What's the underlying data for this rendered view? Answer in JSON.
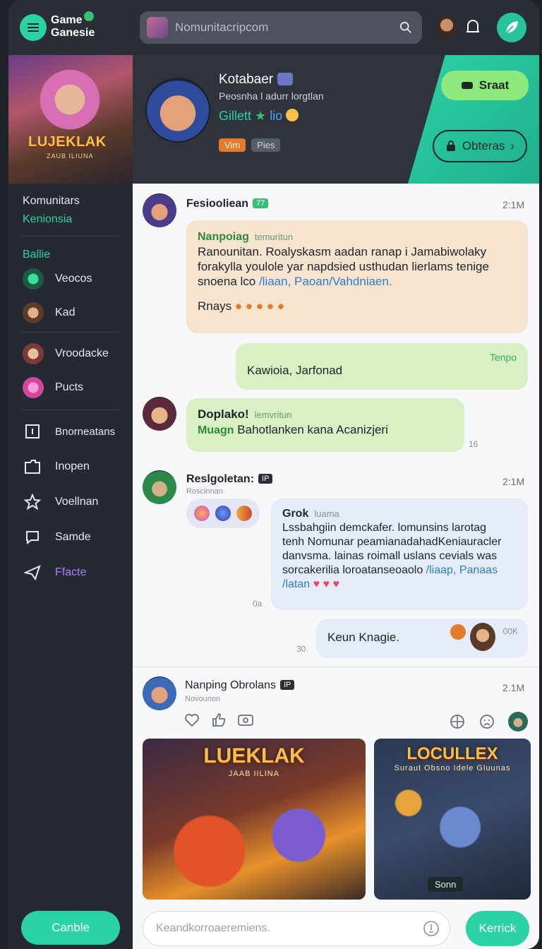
{
  "header": {
    "brand_line1": "Game",
    "brand_line2": "Ganesie",
    "search_placeholder": "Nomunitacripcom"
  },
  "sidebar": {
    "banner_title": "LUJEKLAK",
    "banner_subtitle": "ZAUB ILIUNA",
    "section_title": "Komunitars",
    "section_sub": "Kenionsia",
    "group_label": "Ballie",
    "items": [
      {
        "label": "Veocos",
        "icon": "green-orb-icon"
      },
      {
        "label": "Kad",
        "icon": "hero-avatar-icon"
      },
      {
        "label": "Vroodacke",
        "icon": "hero-avatar-icon"
      },
      {
        "label": "Pucts",
        "icon": "pink-orb-icon"
      }
    ],
    "nav": [
      {
        "label": "Bnorneatans",
        "icon": "square-icon"
      },
      {
        "label": "Inopen",
        "icon": "folder-icon"
      },
      {
        "label": "Voellnan",
        "icon": "star-icon"
      },
      {
        "label": "Samde",
        "icon": "chat-icon"
      },
      {
        "label": "Ffacte",
        "icon": "send-icon"
      }
    ],
    "cancel_label": "Canble"
  },
  "profile": {
    "name": "Kotabaer",
    "subtitle": "Peosnha l adurr lorgtlan",
    "stat_text": "Gillett",
    "stat_extra": "lio",
    "tag1": "Vim",
    "tag2": "Pies",
    "start_label": "Sraat",
    "others_label": "Obteras"
  },
  "messages": [
    {
      "user": "Fesiooliean",
      "badge": "77",
      "time": "2:1M",
      "bubble_name": "Nanpoiag",
      "bubble_meta": "temuritun",
      "text_lines": [
        "Ranounitan. Roalyskasm aadan ranap i Jamabiwolaky",
        "forakylla youlole yar napdsied usthudan lierlams tenige",
        "snoena lco "
      ],
      "link": "/liaan, Paoan/Vahdniaen.",
      "reply_line": "Rnays"
    },
    {
      "self_tag": "Tenpo",
      "text": "Kawioia, Jarfonad"
    },
    {
      "bubble_name": "Doplako!",
      "bubble_meta": "lemvritun",
      "line_prefix": "Muagn",
      "text": "Bahotlanken kana Acanizjeri",
      "side_num": "16"
    },
    {
      "user": "Reslgoletan:",
      "badge": "IP",
      "sub": "Roscinnan",
      "time": "2:1M",
      "bubble_name": "Grok",
      "bubble_meta": "luama",
      "text_lines": [
        "Lssbahgiin demckafer. lomunsins larotag",
        "tenh Nomunar peamianadahadKeniauracler",
        "danvsma. lainas roimall uslans cevials was",
        "sorcakerilia loroatanseoaolo "
      ],
      "link": "/liaap, Panaas",
      "link2": "/latan",
      "side_num": "0a"
    },
    {
      "text": "Keun Knagie.",
      "count": "00K",
      "side_num": "30."
    }
  ],
  "post": {
    "user": "Nanping Obrolans",
    "badge": "IP",
    "sub": "Novounon",
    "time": "2.1M",
    "card1_title": "LUEKLAK",
    "card1_sub": "JAAB IILINA",
    "card2_title": "LOCULLEX",
    "card2_sub": "Suraut Obsno Idele Gluunas",
    "card2_tag": "Sonn"
  },
  "composer": {
    "placeholder": "Keandkorroaeremiens.",
    "send_label": "Kerrick"
  },
  "colors": {
    "accent": "#2bd3a4",
    "sidebar_bg": "#252932",
    "topbar_bg": "#2a2e36"
  }
}
